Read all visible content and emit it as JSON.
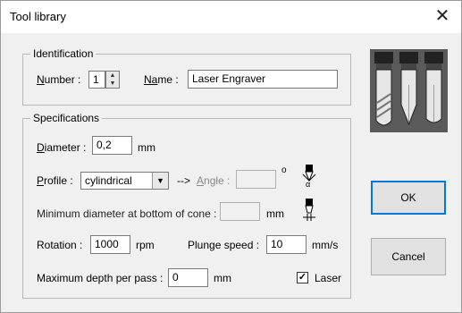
{
  "window": {
    "title": "Tool library",
    "close_glyph": "✕"
  },
  "identification": {
    "legend": "Identification",
    "number_label_u": "N",
    "number_label_rest": "umber :",
    "number_value": "1",
    "name_label_u": "Na",
    "name_label_rest": "me :",
    "name_value": "Laser Engraver"
  },
  "specifications": {
    "legend": "Specifications",
    "diameter_label_u": "D",
    "diameter_label_rest": "iameter :",
    "diameter_value": "0,2",
    "diameter_unit": "mm",
    "profile_label_u": "P",
    "profile_label_rest": "rofile :",
    "profile_value": "cylindrical",
    "arrow_text": "-->",
    "angle_label_u": "A",
    "angle_label_rest": "ngle :",
    "angle_value": "",
    "angle_unit": "o",
    "min_diameter_label": "Minimum diameter at bottom of cone :",
    "min_diameter_value": "",
    "min_diameter_unit": "mm",
    "rotation_label": "Rotation :",
    "rotation_value": "1000",
    "rotation_unit": "rpm",
    "plunge_label": "Plunge speed :",
    "plunge_value": "10",
    "plunge_unit": "mm/s",
    "max_depth_label": "Maximum depth per pass :",
    "max_depth_value": "0",
    "max_depth_unit": "mm",
    "laser_label": "Laser",
    "laser_checked": true,
    "angle_icon_text": "α"
  },
  "buttons": {
    "ok": "OK",
    "cancel": "Cancel"
  },
  "icons": {
    "tool_image": "tool-bits-icon",
    "angle": "cone-angle-icon",
    "min_diameter": "cone-tip-diameter-icon",
    "spin_up": "spin-up-icon",
    "spin_down": "spin-down-icon",
    "dropdown": "chevron-down-icon",
    "close": "close-icon"
  }
}
